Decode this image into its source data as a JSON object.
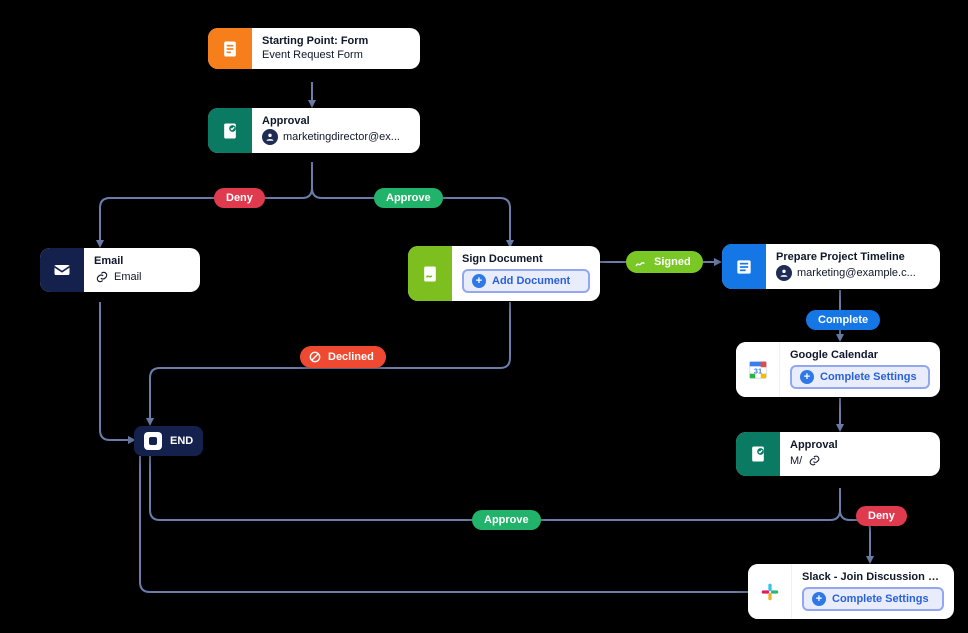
{
  "nodes": {
    "start": {
      "title": "Starting Point: Form",
      "sub": "Event Request Form"
    },
    "approval1": {
      "title": "Approval",
      "sub": "marketingdirector@ex..."
    },
    "email": {
      "title": "Email",
      "sub": "Email"
    },
    "sign": {
      "title": "Sign Document",
      "action": "Add Document"
    },
    "prepare": {
      "title": "Prepare Project Timeline",
      "sub": "marketing@example.c..."
    },
    "gcal": {
      "title": "Google Calendar",
      "action": "Complete Settings"
    },
    "approval2": {
      "title": "Approval",
      "sub": "M/"
    },
    "slack": {
      "title": "Slack - Join Discussion Grou...",
      "action": "Complete Settings"
    },
    "end": {
      "label": "END"
    }
  },
  "pills": {
    "deny1": "Deny",
    "approve1": "Approve",
    "signed": "Signed",
    "declined": "Declined",
    "complete": "Complete",
    "deny2": "Deny",
    "approve2": "Approve"
  }
}
